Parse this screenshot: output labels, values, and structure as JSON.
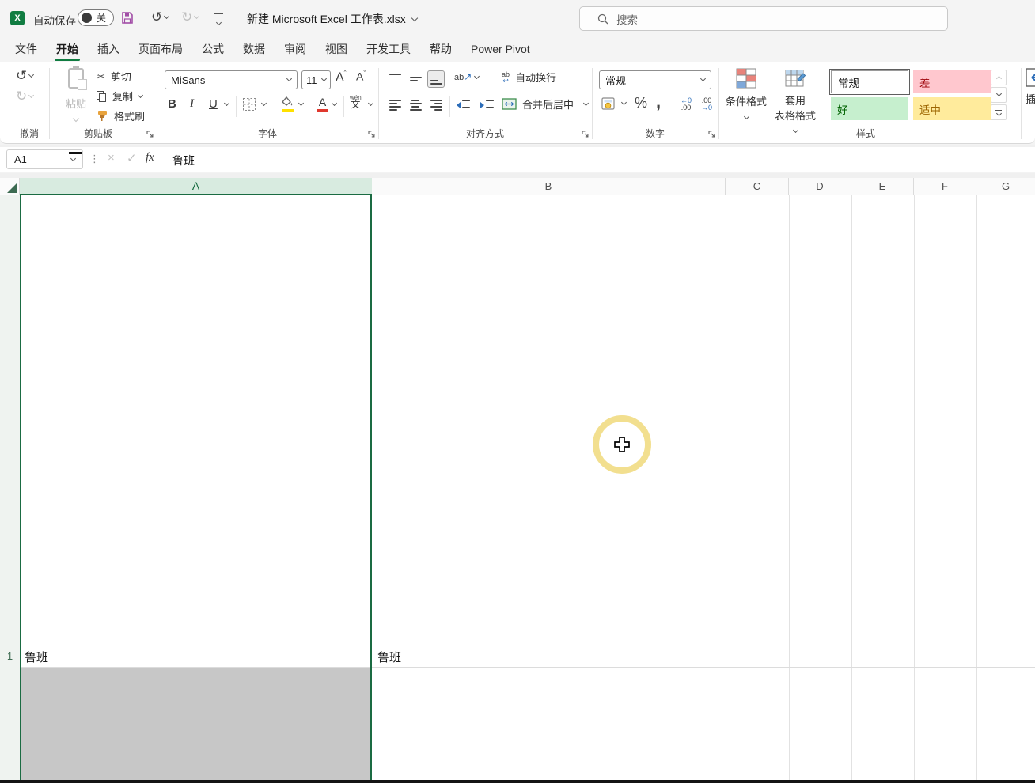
{
  "titlebar": {
    "app_logo": "X",
    "autosave_label": "自动保存",
    "autosave_state": "关",
    "filename": "新建 Microsoft Excel 工作表.xlsx",
    "search_placeholder": "搜索"
  },
  "tabs": [
    {
      "label": "文件"
    },
    {
      "label": "开始"
    },
    {
      "label": "插入"
    },
    {
      "label": "页面布局"
    },
    {
      "label": "公式"
    },
    {
      "label": "数据"
    },
    {
      "label": "审阅"
    },
    {
      "label": "视图"
    },
    {
      "label": "开发工具"
    },
    {
      "label": "帮助"
    },
    {
      "label": "Power Pivot"
    }
  ],
  "ribbon": {
    "undo": {
      "group_label": "撤消"
    },
    "clipboard": {
      "group_label": "剪贴板",
      "paste": "粘贴",
      "cut": "剪切",
      "copy": "复制",
      "format_painter": "格式刷"
    },
    "font": {
      "group_label": "字体",
      "family": "MiSans",
      "size": "11",
      "bold": "B",
      "italic": "I",
      "underline": "U",
      "grow": "A",
      "grow_mark": "ˆ",
      "shrink": "A",
      "shrink_mark": "ˇ",
      "pinyin_top": "wén",
      "pinyin_char": "文"
    },
    "alignment": {
      "group_label": "对齐方式",
      "orient_ab": "ab",
      "wrap_ab": "ab",
      "wrap_arrow": "↩",
      "wrap_text": "自动换行",
      "merge_center": "合并后居中"
    },
    "number": {
      "group_label": "数字",
      "format": "常规",
      "percent": "%",
      "comma": ",",
      "inc_top": "←0",
      "inc_bottom": ".00",
      "dec_top": ".00",
      "dec_bottom": "→0"
    },
    "styles": {
      "group_label": "样式",
      "conditional": "条件格式",
      "format_table_line1": "套用",
      "format_table_line2": "表格格式",
      "cells": [
        {
          "label": "常规",
          "bg": "#FFFFFF",
          "fg": "#1b1b1b"
        },
        {
          "label": "差",
          "bg": "#FFC7CE",
          "fg": "#9C0006"
        },
        {
          "label": "好",
          "bg": "#C6EFCE",
          "fg": "#006100"
        },
        {
          "label": "适中",
          "bg": "#FFEB9C",
          "fg": "#9C6500"
        }
      ]
    },
    "cells_group": {
      "insert_partial": "插"
    }
  },
  "formula_bar": {
    "name_box": "A1",
    "cancel": "×",
    "enter": "✓",
    "fx": "fx",
    "content": "鲁班"
  },
  "grid": {
    "columns": [
      {
        "label": "A"
      },
      {
        "label": "B"
      },
      {
        "label": "C"
      },
      {
        "label": "D"
      },
      {
        "label": "E"
      },
      {
        "label": "F"
      },
      {
        "label": "G"
      }
    ],
    "rows": [
      {
        "number": "1"
      }
    ],
    "cells": {
      "a1": "鲁班",
      "b1": "鲁班"
    }
  },
  "colors": {
    "excel_green": "#107C41",
    "selection_border": "#1A6B42",
    "selected_col_header_bg": "#D8EBE0",
    "a2_fill": "#C7C7C7",
    "click_ring": "#F2DF8F"
  }
}
